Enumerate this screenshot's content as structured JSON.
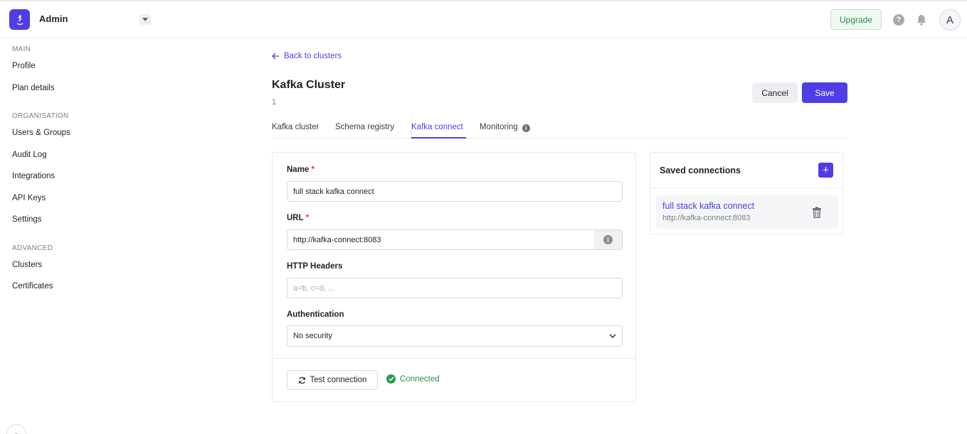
{
  "app": {
    "title": "Admin"
  },
  "header": {
    "upgrade_label": "Upgrade",
    "help_icon": "?",
    "avatar_initial": "A"
  },
  "sidebar": {
    "sections": [
      {
        "title": "MAIN",
        "items": [
          {
            "label": "Profile"
          },
          {
            "label": "Plan details"
          }
        ]
      },
      {
        "title": "ORGANISATION",
        "items": [
          {
            "label": "Users & Groups"
          },
          {
            "label": "Audit Log"
          },
          {
            "label": "Integrations"
          },
          {
            "label": "API Keys"
          },
          {
            "label": "Settings"
          }
        ]
      },
      {
        "title": "ADVANCED",
        "items": [
          {
            "label": "Clusters"
          },
          {
            "label": "Certificates"
          }
        ]
      }
    ],
    "bottom_glyph": "ʗ"
  },
  "page": {
    "back_label": "Back to clusters",
    "title": "Kafka Cluster",
    "subtitle": "1",
    "cancel_label": "Cancel",
    "save_label": "Save",
    "tabs": [
      {
        "label": "Kafka cluster",
        "active": false
      },
      {
        "label": "Schema registry",
        "active": false
      },
      {
        "label": "Kafka connect",
        "active": true
      },
      {
        "label": "Monitoring",
        "active": false
      }
    ]
  },
  "form": {
    "name": {
      "label": "Name",
      "required_mark": "*",
      "value": "full stack kafka connect"
    },
    "url": {
      "label": "URL",
      "required_mark": "*",
      "value": "http://kafka-connect:8083"
    },
    "headers": {
      "label": "HTTP Headers",
      "value": "",
      "placeholder": "a=b, c=d, ..."
    },
    "auth": {
      "label": "Authentication",
      "selected": "No security"
    },
    "test_button_label": "Test connection",
    "status_text": "Connected"
  },
  "saved_connections": {
    "title": "Saved connections",
    "add_icon": "+",
    "items": [
      {
        "name": "full stack kafka connect",
        "url": "http://kafka-connect:8083"
      }
    ]
  },
  "colors": {
    "accent": "#4f3ee6",
    "success": "#2d9c4f",
    "danger": "#e23b3b"
  }
}
